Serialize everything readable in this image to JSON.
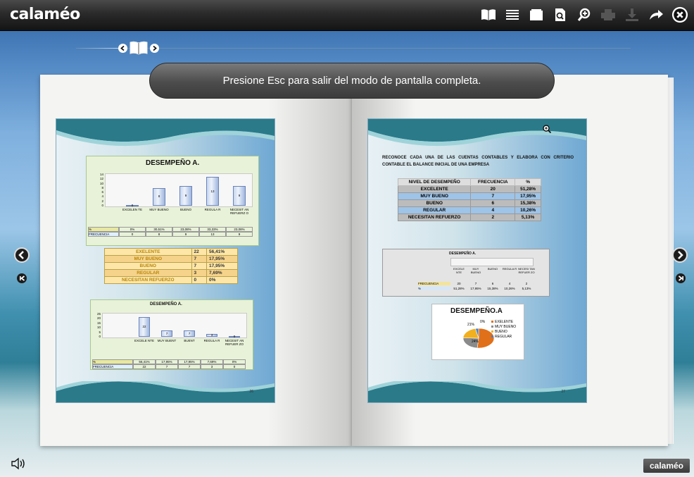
{
  "app": {
    "logo_text": "calaméo",
    "badge_text": "calaméo",
    "fullscreen_notice": "Presione Esc para salir del modo de pantalla completa.",
    "toolbar_icons": [
      "book-view-icon",
      "list-view-icon",
      "single-page-icon",
      "search-page-icon",
      "zoom-icon",
      "print-icon",
      "download-icon",
      "share-icon",
      "close-icon"
    ]
  },
  "left_page": {
    "page_number": "26",
    "chart1": {
      "title": "DESEMPEÑO A.",
      "categories": [
        "EXCELEN TE",
        "MUY BUENO",
        "BUENO",
        "REGULA R",
        "NECESIT AN REFUERZ O"
      ],
      "y_ticks": [
        "14",
        "12",
        "10",
        "8",
        "6",
        "4",
        "2",
        "0"
      ],
      "values": [
        0,
        8,
        9,
        13,
        9
      ],
      "value_labels": [
        "0",
        "8",
        "9",
        "13",
        "9"
      ],
      "pct_row_label": "%",
      "pct_values": [
        "0%",
        "30,51%",
        "23,08%",
        "33,33%",
        "23,08%"
      ],
      "freq_row_label": "FRECUENCIA",
      "freq_values": [
        "0",
        "8",
        "9",
        "13",
        "9"
      ]
    },
    "table": {
      "rows": [
        {
          "label": "EXELENTE",
          "freq": "22",
          "pct": "56,41%"
        },
        {
          "label": "MUY BUENO",
          "freq": "7",
          "pct": "17,95%"
        },
        {
          "label": "BUENO",
          "freq": "7",
          "pct": "17,95%"
        },
        {
          "label": "REGULAR",
          "freq": "3",
          "pct": "7,69%"
        },
        {
          "label": "NECESITAN REFUERZO",
          "freq": "0",
          "pct": "0%"
        }
      ]
    },
    "chart2": {
      "title": "DESEMPEÑO A.",
      "categories": [
        "EXCELE NTE",
        "MUY BUENT",
        "BUENT",
        "REGULA R",
        "NECESIT AN REFUER ZO"
      ],
      "y_ticks": [
        "25",
        "20",
        "15",
        "10",
        "5",
        "0"
      ],
      "values": [
        22,
        7,
        7,
        3,
        0
      ],
      "value_labels": [
        "22",
        "7",
        "7",
        "3",
        "0"
      ],
      "pct_row_label": "%",
      "pct_values": [
        "56,41%",
        "17,95%",
        "17,95%",
        "7,69%",
        "0%"
      ],
      "freq_row_label": "FRECUENCIA",
      "freq_values": [
        "22",
        "7",
        "7",
        "3",
        "0"
      ]
    }
  },
  "right_page": {
    "page_number": "27",
    "heading": "RECONOCE CADA UNA DE LAS CUENTAS CONTABLES Y ELABORA CON CRITERIO CONTABLE EL BALANCE INICIAL DE UNA EMPRESA",
    "table": {
      "headers": [
        "NIVEL DE DESEMPEÑO",
        "FRECUENCIA",
        "%"
      ],
      "rows": [
        {
          "label": "EXCELENTE",
          "freq": "20",
          "pct": "51,28%"
        },
        {
          "label": "MUY BUENO",
          "freq": "7",
          "pct": "17,95%"
        },
        {
          "label": "BUENO",
          "freq": "6",
          "pct": "15,38%"
        },
        {
          "label": "REGULAR",
          "freq": "4",
          "pct": "10,26%"
        },
        {
          "label": "NECESITAN REFUERZO",
          "freq": "2",
          "pct": "5,13%"
        }
      ]
    },
    "chart3": {
      "title": "DESEMPEÑO A.",
      "categories": [
        "EXCELE NTE",
        "MUY BUENO",
        "BUENO",
        "REGULA R",
        "NECESI TAN REFUER ZO"
      ],
      "freq_row_label": "FRECUENCIA",
      "freq_values": [
        "20",
        "7",
        "6",
        "4",
        "2"
      ],
      "pct_row_label": "%",
      "pct_values": [
        "51,28%",
        "17,95%",
        "15,38%",
        "10,26%",
        "5,13%"
      ]
    },
    "pie": {
      "title": "DESEMPEÑO.A",
      "legend": [
        "EXELENTE",
        "MUY BUENO",
        "BUENO",
        "REGULAR"
      ],
      "labels": [
        "21%",
        "0%",
        "24%"
      ]
    }
  }
}
